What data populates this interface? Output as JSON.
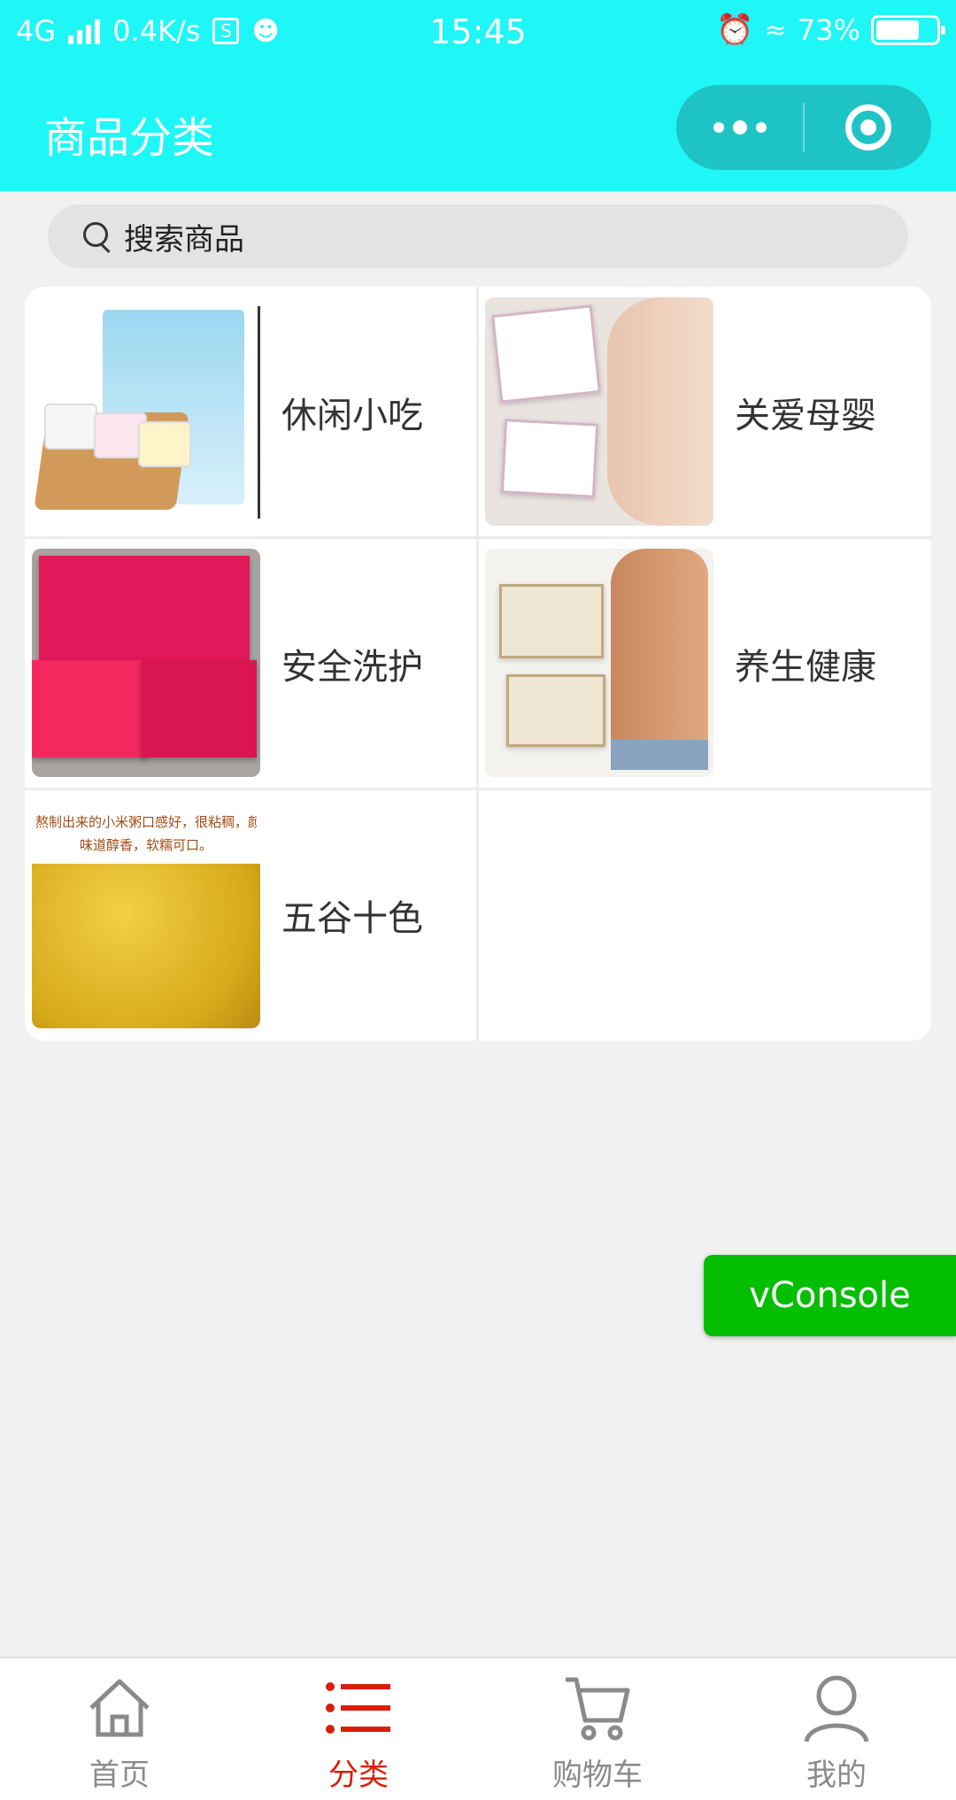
{
  "status_bar": {
    "network": "4G",
    "speed": "0.4K/s",
    "time": "15:45",
    "battery": "73%",
    "battery_level": 0.73
  },
  "nav": {
    "title": "商品分类"
  },
  "search": {
    "placeholder": "搜索商品"
  },
  "categories": [
    {
      "label": "休闲小吃",
      "icon": "snack-image"
    },
    {
      "label": "关爱母婴",
      "icon": "maternal-care-image"
    },
    {
      "label": "安全洗护",
      "icon": "wash-care-image"
    },
    {
      "label": "养生健康",
      "icon": "health-image"
    },
    {
      "label": "五谷十色",
      "icon": "grain-image"
    }
  ],
  "millet_caption": [
    "熬制出来的小米粥口感好，很粘稠，颜色金",
    "味道醇香，软糯可口。"
  ],
  "vconsole": {
    "label": "vConsole"
  },
  "tabbar": {
    "items": [
      {
        "label": "首页",
        "icon": "home-icon"
      },
      {
        "label": "分类",
        "icon": "list-icon",
        "active": true
      },
      {
        "label": "购物车",
        "icon": "cart-icon"
      },
      {
        "label": "我的",
        "icon": "user-icon"
      }
    ]
  },
  "colors": {
    "header": "#1ff6f6",
    "capsule": "#1ec3c6",
    "active_tab": "#d81e06",
    "inactive_tab": "#8a8a8a",
    "vconsole": "#04be02"
  }
}
